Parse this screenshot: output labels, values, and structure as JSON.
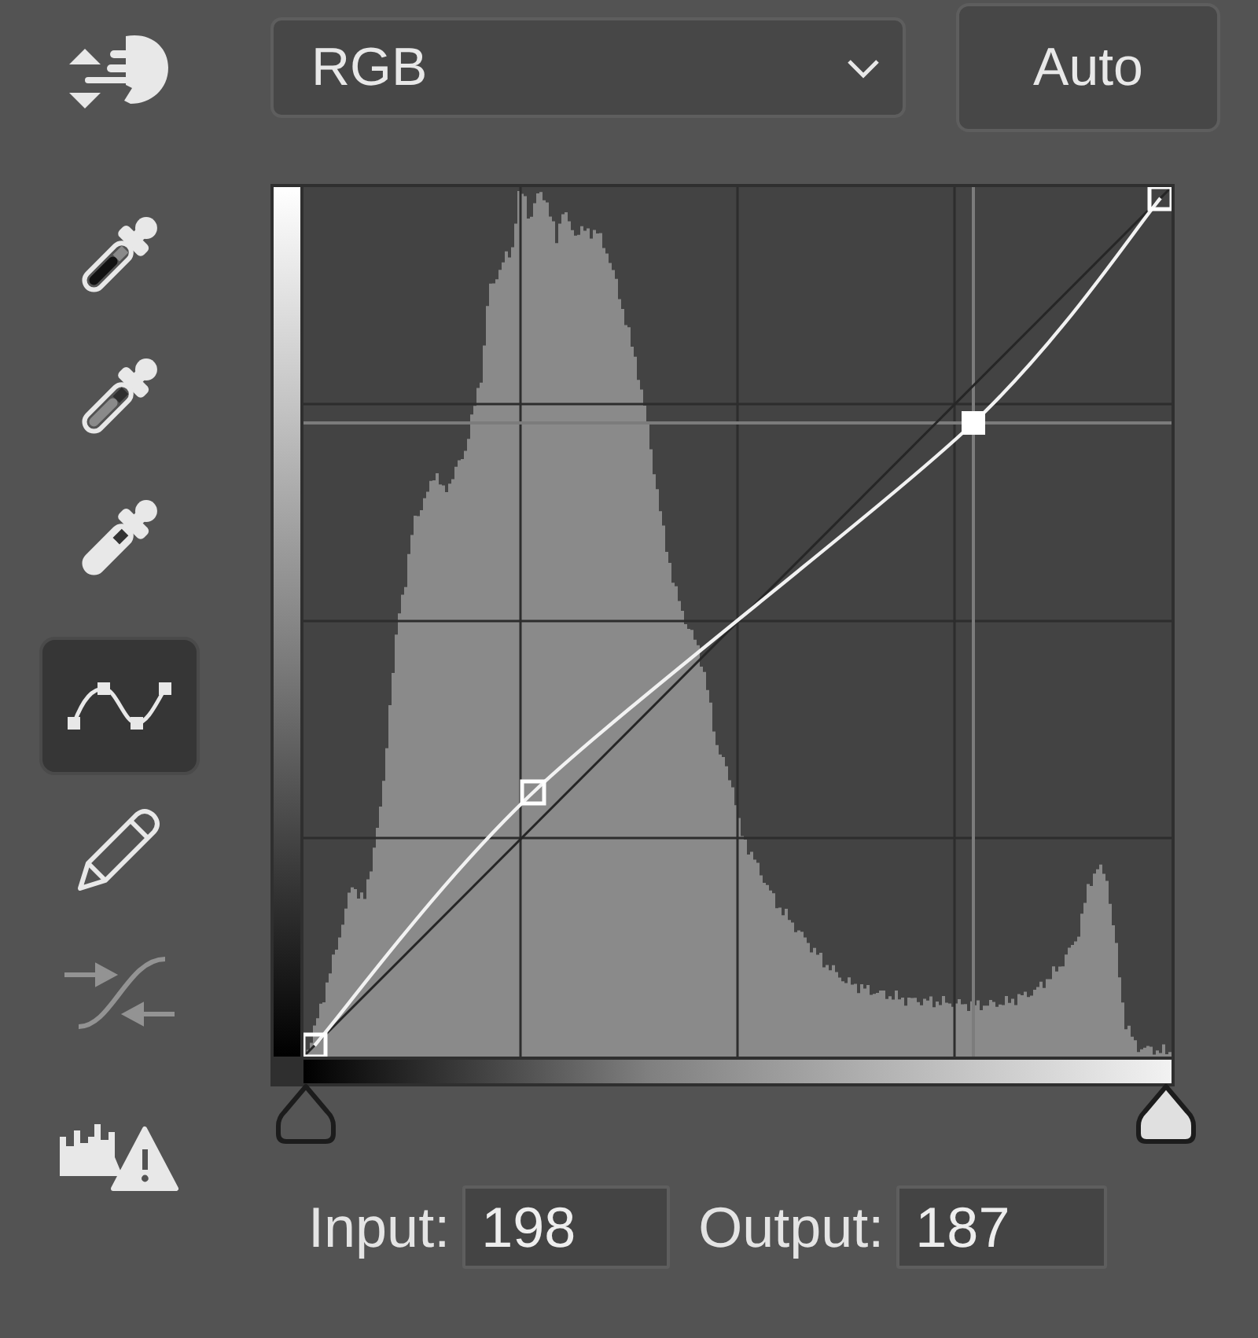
{
  "tools": [
    {
      "kind": "target",
      "selected": false,
      "disabled": false
    },
    {
      "kind": "shadowdropper",
      "selected": false,
      "disabled": false
    },
    {
      "kind": "midtonedropper",
      "selected": false,
      "disabled": false
    },
    {
      "kind": "highlightdropper",
      "selected": false,
      "disabled": false
    },
    {
      "kind": "point",
      "selected": true,
      "disabled": false
    },
    {
      "kind": "pencil",
      "selected": false,
      "disabled": false
    },
    {
      "kind": "smooth",
      "selected": false,
      "disabled": true
    },
    {
      "kind": "clipping",
      "selected": false,
      "disabled": false
    }
  ],
  "channel_dropdown": {
    "value": "RGB"
  },
  "auto_button": {
    "label": "Auto"
  },
  "curve_points": [
    {
      "selected": false
    },
    {
      "selected": false
    },
    {
      "selected": true
    },
    {
      "selected": false
    }
  ],
  "input": {
    "label": "Input:",
    "value": "198"
  },
  "output": {
    "label": "Output:",
    "value": "187"
  }
}
